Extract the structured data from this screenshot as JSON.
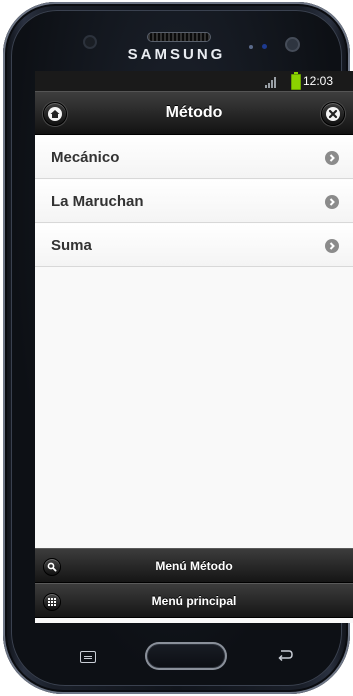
{
  "device": {
    "brand": "SAMSUNG"
  },
  "status_bar": {
    "time": "12:03",
    "icons": [
      "signal-icon",
      "battery-icon"
    ],
    "battery_color": "#8bd300"
  },
  "header": {
    "title": "Método",
    "left_button_icon": "home-icon",
    "right_button_icon": "close-icon"
  },
  "list": {
    "items": [
      {
        "label": "Mecánico",
        "icon": "chevron-right-icon"
      },
      {
        "label": "La Maruchan",
        "icon": "chevron-right-icon"
      },
      {
        "label": "Suma",
        "icon": "chevron-right-icon"
      }
    ]
  },
  "footer": {
    "buttons": [
      {
        "label": "Menú Método",
        "icon": "search-icon"
      },
      {
        "label": "Menú principal",
        "icon": "grid-icon"
      }
    ]
  },
  "hardware_keys": [
    "menu-key-icon",
    "home-key",
    "back-key-icon"
  ]
}
